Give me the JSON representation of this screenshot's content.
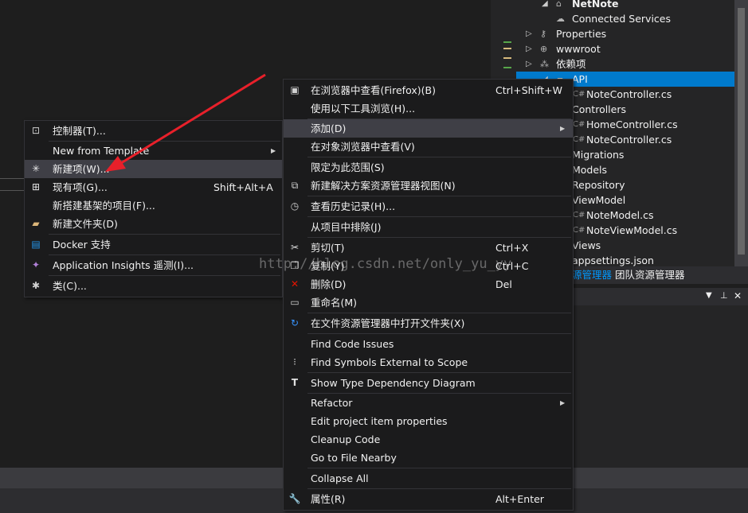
{
  "solution_explorer": {
    "rows": [
      {
        "label": "NetNote",
        "bold": true
      },
      {
        "label": "Connected Services"
      },
      {
        "label": "Properties"
      },
      {
        "label": "wwwroot"
      },
      {
        "label": "依赖项"
      },
      {
        "label": "API",
        "selected": true
      },
      {
        "label": "NoteController.cs",
        "cs": true
      },
      {
        "label": "Controllers"
      },
      {
        "label": "HomeController.cs",
        "cs": true
      },
      {
        "label": "NoteController.cs",
        "cs": true
      },
      {
        "label": "Migrations"
      },
      {
        "label": "Models"
      },
      {
        "label": "Repository"
      },
      {
        "label": "ViewModel"
      },
      {
        "label": "NoteModel.cs",
        "cs": true
      },
      {
        "label": "NoteViewModel.cs",
        "cs": true
      },
      {
        "label": "Views"
      },
      {
        "label": "appsettings.json"
      }
    ],
    "tabs": {
      "solution": "源管理器",
      "team": "团队资源管理器"
    },
    "panel_buttons": {
      "dropdown": "▼",
      "pin": "📌",
      "close": "✕"
    }
  },
  "context_menu": {
    "items": {
      "view_in_browser": {
        "label": "在浏览器中查看(Firefox)(B)",
        "shortcut": "Ctrl+Shift+W"
      },
      "browse_with": {
        "label": "使用以下工具浏览(H)..."
      },
      "add": {
        "label": "添加(D)"
      },
      "view_object_browser": {
        "label": "在对象浏览器中查看(V)"
      },
      "scope_to_this": {
        "label": "限定为此范围(S)"
      },
      "new_solution_view": {
        "label": "新建解决方案资源管理器视图(N)"
      },
      "view_history": {
        "label": "查看历史记录(H)..."
      },
      "exclude": {
        "label": "从项目中排除(J)"
      },
      "cut": {
        "label": "剪切(T)",
        "shortcut": "Ctrl+X"
      },
      "copy": {
        "label": "复制(Y)",
        "shortcut": "Ctrl+C"
      },
      "delete": {
        "label": "删除(D)",
        "shortcut": "Del"
      },
      "rename": {
        "label": "重命名(M)"
      },
      "open_folder": {
        "label": "在文件资源管理器中打开文件夹(X)"
      },
      "find_code_issues": {
        "label": "Find Code Issues"
      },
      "find_symbols": {
        "label": "Find Symbols External to Scope"
      },
      "type_dependency": {
        "label": "Show Type Dependency Diagram"
      },
      "refactor": {
        "label": "Refactor"
      },
      "edit_properties": {
        "label": "Edit project item properties"
      },
      "cleanup": {
        "label": "Cleanup Code"
      },
      "go_to_file": {
        "label": "Go to File Nearby"
      },
      "collapse_all": {
        "label": "Collapse All"
      },
      "properties": {
        "label": "属性(R)",
        "shortcut": "Alt+Enter"
      }
    }
  },
  "add_submenu": {
    "items": {
      "controller": {
        "label": "控制器(T)..."
      },
      "new_from_template": {
        "label": "New from Template"
      },
      "new_item": {
        "label": "新建项(W)..."
      },
      "existing_item": {
        "label": "现有项(G)...",
        "shortcut": "Shift+Alt+A"
      },
      "new_scaffolded": {
        "label": "新搭建基架的项目(F)..."
      },
      "new_folder": {
        "label": "新建文件夹(D)"
      },
      "docker": {
        "label": "Docker 支持"
      },
      "app_insights": {
        "label": "Application Insights 遥测(I)..."
      },
      "class": {
        "label": "类(C)..."
      }
    }
  },
  "watermark": "http://blog.csdn.net/only_yu_yy",
  "colors": {
    "accent": "#007acc",
    "arrow": "#e8202a",
    "menu_bg": "#1b1b1c",
    "highlight": "#3f3f46"
  }
}
